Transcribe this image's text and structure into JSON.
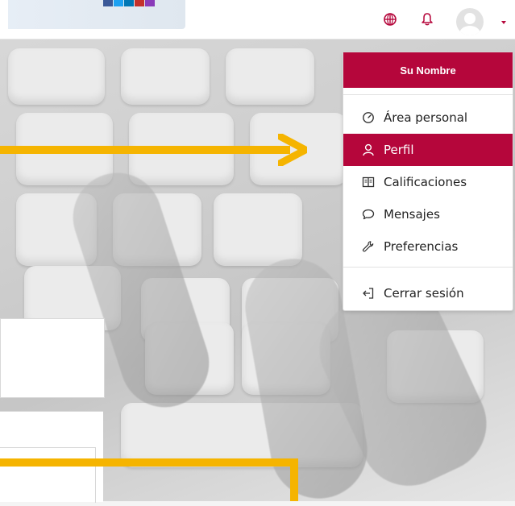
{
  "header": {
    "icons": {
      "globe": "globe-icon",
      "bell": "bell-icon",
      "avatar": "avatar",
      "caret": "chevron-down-icon"
    }
  },
  "dropdown": {
    "header_label": "Su Nombre",
    "items": [
      {
        "label": "Área personal",
        "icon": "dashboard-gauge-icon",
        "active": false
      },
      {
        "label": "Perfil",
        "icon": "user-icon",
        "active": true
      },
      {
        "label": "Calificaciones",
        "icon": "grades-book-icon",
        "active": false
      },
      {
        "label": "Mensajes",
        "icon": "message-bubble-icon",
        "active": false
      },
      {
        "label": "Preferencias",
        "icon": "wrench-icon",
        "active": false
      }
    ],
    "logout_label": "Cerrar sesión"
  },
  "colors": {
    "brand": "#b5063b",
    "annotation_arrow": "#f5b400"
  }
}
